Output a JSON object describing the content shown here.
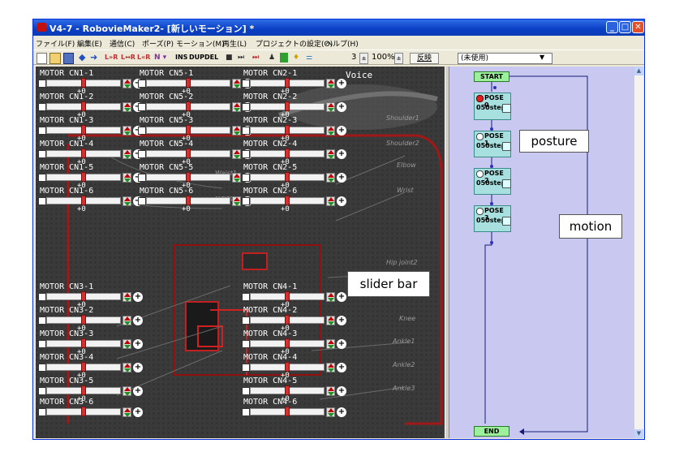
{
  "window": {
    "title": "V4-7 - RobovieMaker2- [新しいモーション] *"
  },
  "menu": [
    "ファイル(F)",
    "編集(E)",
    "通信(C)",
    "ポーズ(P)",
    "モーション(M)",
    "再生(L)",
    "プロジェクトの設定(O)",
    "ヘルプ(H)"
  ],
  "toolbar": {
    "ins": "INS",
    "dup": "DUP",
    "del": "DEL",
    "step_value": "3",
    "zoom": "100%",
    "apply": "反映",
    "unused": "(未使用)",
    "lr1": "L»R",
    "lr2": "L↔R",
    "lr3": "L«R"
  },
  "motors": {
    "col1": [
      {
        "name": "MOTOR CN1-1",
        "value": "+0"
      },
      {
        "name": "MOTOR CN1-2",
        "value": "+0"
      },
      {
        "name": "MOTOR CN1-3",
        "value": "+0"
      },
      {
        "name": "MOTOR CN1-4",
        "value": "+0"
      },
      {
        "name": "MOTOR CN1-5",
        "value": "+0"
      },
      {
        "name": "MOTOR CN1-6",
        "value": "+0"
      },
      {
        "name": "MOTOR CN3-1",
        "value": "+0"
      },
      {
        "name": "MOTOR CN3-2",
        "value": "+0"
      },
      {
        "name": "MOTOR CN3-3",
        "value": "+0"
      },
      {
        "name": "MOTOR CN3-4",
        "value": "+0"
      },
      {
        "name": "MOTOR CN3-5",
        "value": "+0"
      },
      {
        "name": "MOTOR CN3-6",
        "value": ""
      }
    ],
    "col2": [
      {
        "name": "MOTOR CN5-1",
        "value": "+0"
      },
      {
        "name": "MOTOR CN5-2",
        "value": "+0"
      },
      {
        "name": "MOTOR CN5-3",
        "value": "+0"
      },
      {
        "name": "MOTOR CN5-4",
        "value": "+0"
      },
      {
        "name": "MOTOR CN5-5",
        "value": "+0"
      },
      {
        "name": "MOTOR CN5-6",
        "value": "+0"
      }
    ],
    "col3": [
      {
        "name": "MOTOR CN2-1",
        "value": "+0"
      },
      {
        "name": "MOTOR CN2-2",
        "value": "+0"
      },
      {
        "name": "MOTOR CN2-3",
        "value": "+0"
      },
      {
        "name": "MOTOR CN2-4",
        "value": "+0"
      },
      {
        "name": "MOTOR CN2-5",
        "value": "+0"
      },
      {
        "name": "MOTOR CN2-6",
        "value": "+0"
      },
      {
        "name": "MOTOR CN4-1",
        "value": "+0"
      },
      {
        "name": "MOTOR CN4-2",
        "value": "+0"
      },
      {
        "name": "MOTOR CN4-3",
        "value": "+0"
      },
      {
        "name": "MOTOR CN4-4",
        "value": "+0"
      },
      {
        "name": "MOTOR CN4-5",
        "value": "+0"
      },
      {
        "name": "MOTOR CN4-6",
        "value": ""
      }
    ]
  },
  "voice_label": "Voice",
  "body_labels": {
    "shoulder1": "Shoulder1",
    "shoulder2": "Shoulder2",
    "elbow": "Elbow",
    "wrist": "Wrist",
    "waist1": "Waist1",
    "waist2": "Waist2",
    "hipjoint2": "Hip joint2",
    "knee": "Knee",
    "ankle1": "Ankle1",
    "ankle2": "Ankle2",
    "ankle3": "Ankle3"
  },
  "flow": {
    "start": "START",
    "end": "END",
    "poses": [
      {
        "name": "POSE 0",
        "step": "050step",
        "active": true
      },
      {
        "name": "POSE 1",
        "step": "050step",
        "active": false
      },
      {
        "name": "POSE 2",
        "step": "050step",
        "active": false
      },
      {
        "name": "POSE 3",
        "step": "050step",
        "active": false
      }
    ]
  },
  "annotations": {
    "slider": "slider bar",
    "posture": "posture",
    "motion": "motion"
  },
  "colors": {
    "title_bar": "#0a3fc4",
    "panel_bg": "#383838",
    "flow_bg": "#c8c8f0",
    "node": "#a8e0e0",
    "slider_thumb": "#d43030"
  }
}
